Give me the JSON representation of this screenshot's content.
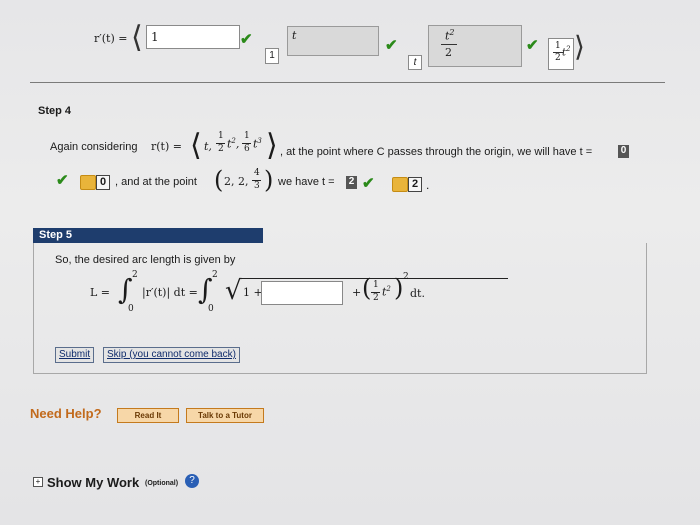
{
  "top_row": {
    "r_prime_label": "r′(t) =",
    "first_input_value": "1",
    "small_box_1": "1",
    "second_input_value": "t",
    "small_box_2": "t",
    "third_input_numerator": "t",
    "third_input_exp": "2",
    "third_input_denominator": "2",
    "final_fraction_num": "1",
    "final_fraction_den": "2",
    "final_exp": "2"
  },
  "step4": {
    "title": "Step 4",
    "sentence_start": "Again considering",
    "r_label": "r(t) =",
    "vector_text": "t, 1/2 t², 1/6 t³",
    "sentence_mid": ", at the point where C passes through the origin, we will have t =",
    "t_answer": "0",
    "pencil_answer_1": "0",
    "and_point": ", and at the point",
    "point_text": "(2, 2, 4/3)",
    "we_have": "we have t =",
    "t_answer_2": "2",
    "pencil_answer_2": "2",
    "period": "."
  },
  "step5": {
    "title": "Step 5",
    "intro": "So, the desired arc length is given by",
    "L_label": "L =",
    "integrand1": "|r′(t)| dt =",
    "upper_limit": "2",
    "lower_limit": "0",
    "sqrt_inner": "1 +",
    "answer_value": "",
    "plus": "+",
    "tail": "dt."
  },
  "buttons": {
    "submit": "Submit",
    "skip": "Skip (you cannot come back)"
  },
  "help": {
    "label": "Need Help?",
    "read_it": "Read It",
    "talk": "Talk to a Tutor"
  },
  "footer": {
    "show_work": "Show My Work",
    "optional": "(Optional)"
  }
}
